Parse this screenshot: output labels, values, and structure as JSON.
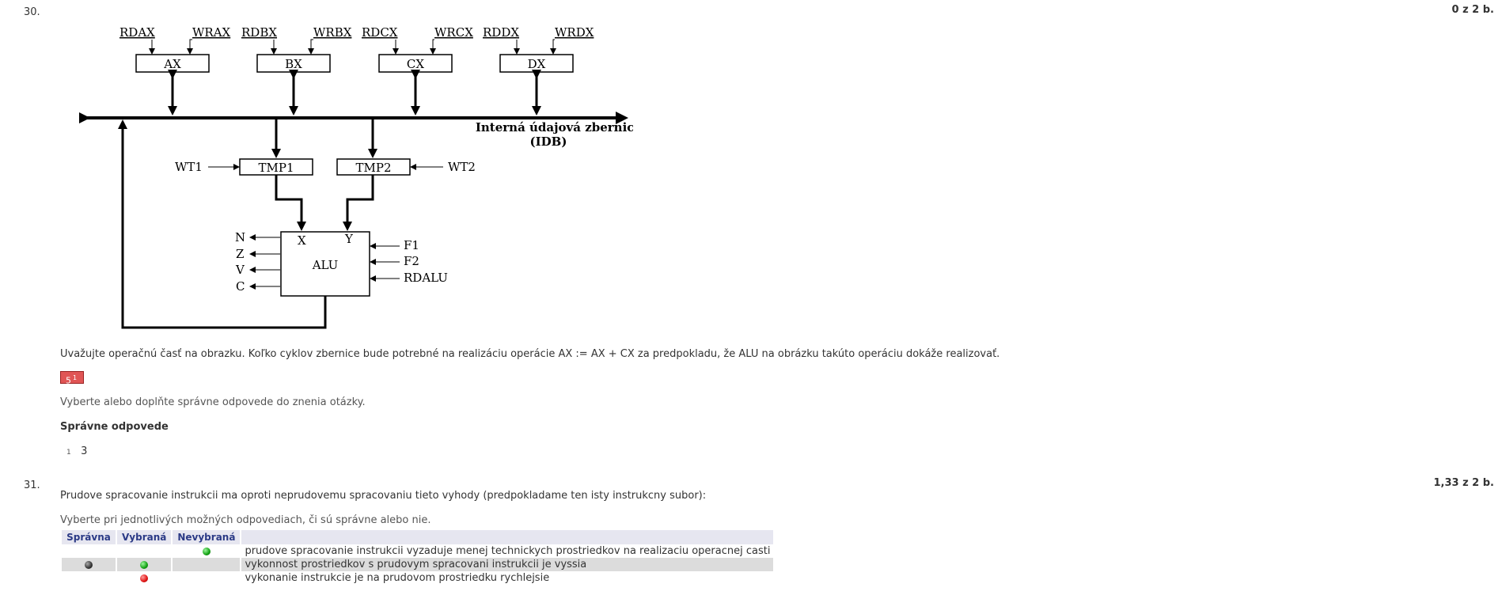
{
  "q30": {
    "number": "30.",
    "score": "0 z 2 b.",
    "diagram": {
      "regs": [
        {
          "name": "AX",
          "rd": "RDAX",
          "wr": "WRAX"
        },
        {
          "name": "BX",
          "rd": "RDBX",
          "wr": "WRBX"
        },
        {
          "name": "CX",
          "rd": "RDCX",
          "wr": "WRCX"
        },
        {
          "name": "DX",
          "rd": "RDDX",
          "wr": "WRDX"
        }
      ],
      "bus_label_1": "Interná údajová zbernica",
      "bus_label_2": "(IDB)",
      "tmp1": "TMP1",
      "tmp2": "TMP2",
      "wt1": "WT1",
      "wt2": "WT2",
      "alu": "ALU",
      "alu_x": "X",
      "alu_y": "Y",
      "flags": [
        "N",
        "Z",
        "V",
        "C"
      ],
      "inputs": [
        "F1",
        "F2",
        "RDALU"
      ]
    },
    "question": "Uvažujte operačnú časť na obrazku. Koľko cyklov zbernice bude potrebné na realizáciu operácie AX := AX + CX za predpokladu, že ALU na obrázku takúto operáciu dokáže realizovať.",
    "answer_value": "5",
    "answer_mark": "1",
    "instruction": "Vyberte alebo doplňte správne odpovede do znenia otázky.",
    "correct_heading": "Správne odpovede",
    "correct_index": "1",
    "correct_value": "3"
  },
  "q31": {
    "number": "31.",
    "score": "1,33 z 2 b.",
    "question": "Prudove spracovanie instrukcii ma oproti neprudovemu spracovaniu tieto vyhody (predpokladame ten isty instrukcny subor):",
    "instruction": "Vyberte pri jednotlivých možných odpovediach, či sú správne alebo nie.",
    "headers": [
      "Správna",
      "Vybraná",
      "Nevybraná",
      ""
    ],
    "rows": [
      {
        "text": "prudove spracovanie instrukcii vyzaduje menej technickych prostriedkov na realizaciu operacnej casti",
        "correct": "",
        "selected": "",
        "unselected": "green"
      },
      {
        "text": "vykonnost prostriedkov s prudovym spracovani instrukcii je vyssia",
        "correct": "dark",
        "selected": "green",
        "unselected": ""
      },
      {
        "text": "vykonanie instrukcie je na prudovom prostriedku rychlejsie",
        "correct": "",
        "selected": "red",
        "unselected": ""
      }
    ]
  }
}
